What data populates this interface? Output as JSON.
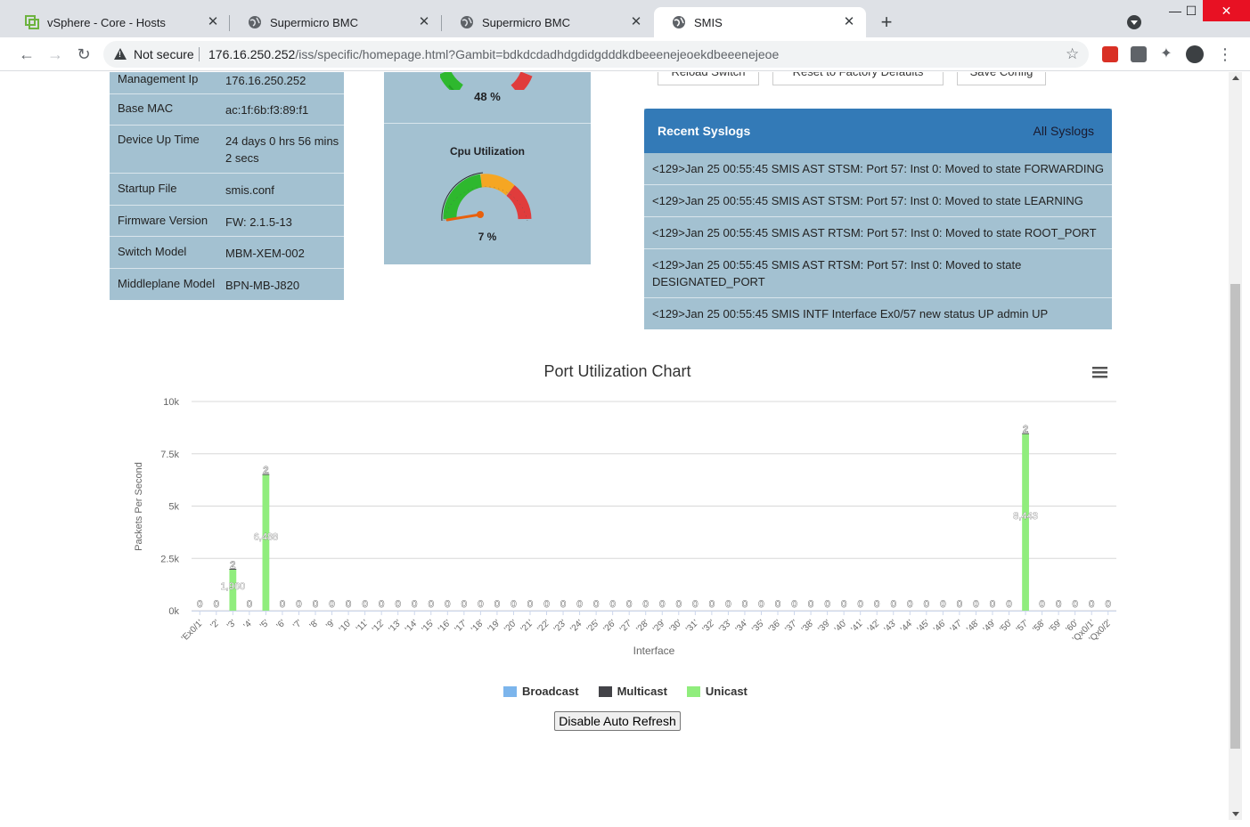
{
  "browser": {
    "tabs": [
      {
        "title": "vSphere - Core - Hosts",
        "icon": "vsphere-icon"
      },
      {
        "title": "Supermicro BMC",
        "icon": "globe-icon"
      },
      {
        "title": "Supermicro BMC",
        "icon": "globe-icon"
      },
      {
        "title": "SMIS",
        "icon": "globe-icon",
        "active": true
      }
    ],
    "new_tab": "+",
    "not_secure": "Not secure",
    "url_host": "176.16.250.252",
    "url_path": "/iss/specific/homepage.html?Gambit=bdkdcdadhdgdidgdddkdbeeenejeoekdbeeenejeoe"
  },
  "info": [
    {
      "key": "Management Ip",
      "value": "176.16.250.252"
    },
    {
      "key": "Base MAC",
      "value": "ac:1f:6b:f3:89:f1"
    },
    {
      "key": "Device Up Time",
      "value": "24 days 0 hrs 56 mins 2 secs"
    },
    {
      "key": "Startup File",
      "value": "smis.conf"
    },
    {
      "key": "Firmware Version",
      "value": "FW: 2.1.5-13"
    },
    {
      "key": "Switch Model",
      "value": "MBM-XEM-002"
    },
    {
      "key": "Middleplane Model",
      "value": "BPN-MB-J820"
    }
  ],
  "gauges": {
    "memory_pct": "48 %",
    "memory_value": 48,
    "cpu_title": "Cpu Utilization",
    "cpu_pct": "7 %",
    "cpu_value": 7
  },
  "top_buttons": [
    "Reload Switch",
    "Reset to Factory Defaults",
    "Save Config"
  ],
  "syslog": {
    "title": "Recent Syslogs",
    "all_link": "All Syslogs",
    "entries": [
      "<129>Jan 25 00:55:45 SMIS AST STSM: Port 57: Inst 0: Moved to state FORWARDING",
      "<129>Jan 25 00:55:45 SMIS AST STSM: Port 57: Inst 0: Moved to state LEARNING",
      "<129>Jan 25 00:55:45 SMIS AST RTSM: Port 57: Inst 0: Moved to state ROOT_PORT",
      "<129>Jan 25 00:55:45 SMIS AST RTSM: Port 57: Inst 0: Moved to state DESIGNATED_PORT",
      "<129>Jan 25 00:55:45 SMIS INTF Interface Ex0/57 new status UP admin UP"
    ]
  },
  "chart_data": {
    "type": "bar",
    "title": "Port Utilization Chart",
    "xlabel": "Interface",
    "ylabel": "Packets Per Second",
    "ylim": [
      0,
      10000
    ],
    "yticks": [
      "0k",
      "2.5k",
      "5k",
      "7.5k",
      "10k"
    ],
    "grid": true,
    "legend_position": "bottom",
    "categories": [
      "'Ex0/1'",
      "'2'",
      "'3'",
      "'4'",
      "'5'",
      "'6'",
      "'7'",
      "'8'",
      "'9'",
      "'10'",
      "'11'",
      "'12'",
      "'13'",
      "'14'",
      "'15'",
      "'16'",
      "'17'",
      "'18'",
      "'19'",
      "'20'",
      "'21'",
      "'22'",
      "'23'",
      "'24'",
      "'25'",
      "'26'",
      "'27'",
      "'28'",
      "'29'",
      "'30'",
      "'31'",
      "'32'",
      "'33'",
      "'34'",
      "'35'",
      "'36'",
      "'37'",
      "'38'",
      "'39'",
      "'40'",
      "'41'",
      "'42'",
      "'43'",
      "'44'",
      "'45'",
      "'46'",
      "'47'",
      "'48'",
      "'49'",
      "'50'",
      "'57'",
      "'58'",
      "'59'",
      "'60'",
      "'Qx0/1'",
      "'Qx0/2'"
    ],
    "series": [
      {
        "name": "Broadcast",
        "color": "#7cb5ec",
        "values": [
          0,
          0,
          0,
          0,
          0,
          0,
          0,
          0,
          0,
          0,
          0,
          0,
          0,
          0,
          0,
          0,
          0,
          0,
          0,
          0,
          0,
          0,
          0,
          0,
          0,
          0,
          0,
          0,
          0,
          0,
          0,
          0,
          0,
          0,
          0,
          0,
          0,
          0,
          0,
          0,
          0,
          0,
          0,
          0,
          0,
          0,
          0,
          0,
          0,
          0,
          0,
          0,
          0,
          0,
          0,
          0
        ]
      },
      {
        "name": "Multicast",
        "color": "#434348",
        "values": [
          0,
          0,
          2,
          0,
          2,
          0,
          0,
          0,
          0,
          0,
          0,
          0,
          0,
          0,
          0,
          0,
          0,
          0,
          0,
          0,
          0,
          0,
          0,
          0,
          0,
          0,
          0,
          0,
          0,
          0,
          0,
          0,
          0,
          0,
          0,
          0,
          0,
          0,
          0,
          0,
          0,
          0,
          0,
          0,
          0,
          0,
          0,
          0,
          0,
          0,
          2,
          0,
          0,
          0,
          0,
          0
        ]
      },
      {
        "name": "Unicast",
        "color": "#90ed7d",
        "values": [
          0,
          0,
          1960,
          0,
          6488,
          0,
          0,
          0,
          0,
          0,
          0,
          0,
          0,
          0,
          0,
          0,
          0,
          0,
          0,
          0,
          0,
          0,
          0,
          0,
          0,
          0,
          0,
          0,
          0,
          0,
          0,
          0,
          0,
          0,
          0,
          0,
          0,
          0,
          0,
          0,
          0,
          0,
          0,
          0,
          0,
          0,
          0,
          0,
          0,
          0,
          8443,
          0,
          0,
          0,
          0,
          0
        ]
      }
    ],
    "value_labels": [
      "0",
      "0",
      "1,960",
      "0",
      "6,488",
      "0",
      "0",
      "0",
      "0",
      "0",
      "0",
      "0",
      "0",
      "0",
      "0",
      "0",
      "0",
      "0",
      "0",
      "0",
      "0",
      "0",
      "0",
      "0",
      "0",
      "0",
      "0",
      "0",
      "0",
      "0",
      "0",
      "0",
      "0",
      "0",
      "0",
      "0",
      "0",
      "0",
      "0",
      "0",
      "0",
      "0",
      "0",
      "0",
      "0",
      "0",
      "0",
      "0",
      "0",
      "0",
      "8,443",
      "0",
      "0",
      "0",
      "0",
      "0"
    ],
    "top_labels": [
      "0",
      "0",
      "2",
      "0",
      "2",
      "0",
      "0",
      "0",
      "0",
      "0",
      "0",
      "0",
      "0",
      "0",
      "0",
      "0",
      "0",
      "0",
      "0",
      "0",
      "0",
      "0",
      "0",
      "0",
      "0",
      "0",
      "0",
      "0",
      "0",
      "0",
      "0",
      "0",
      "0",
      "0",
      "0",
      "0",
      "0",
      "0",
      "0",
      "0",
      "0",
      "0",
      "0",
      "0",
      "0",
      "0",
      "0",
      "0",
      "0",
      "0",
      "2",
      "0",
      "0",
      "0",
      "0",
      "0"
    ]
  },
  "refresh_button": "Disable Auto Refresh"
}
